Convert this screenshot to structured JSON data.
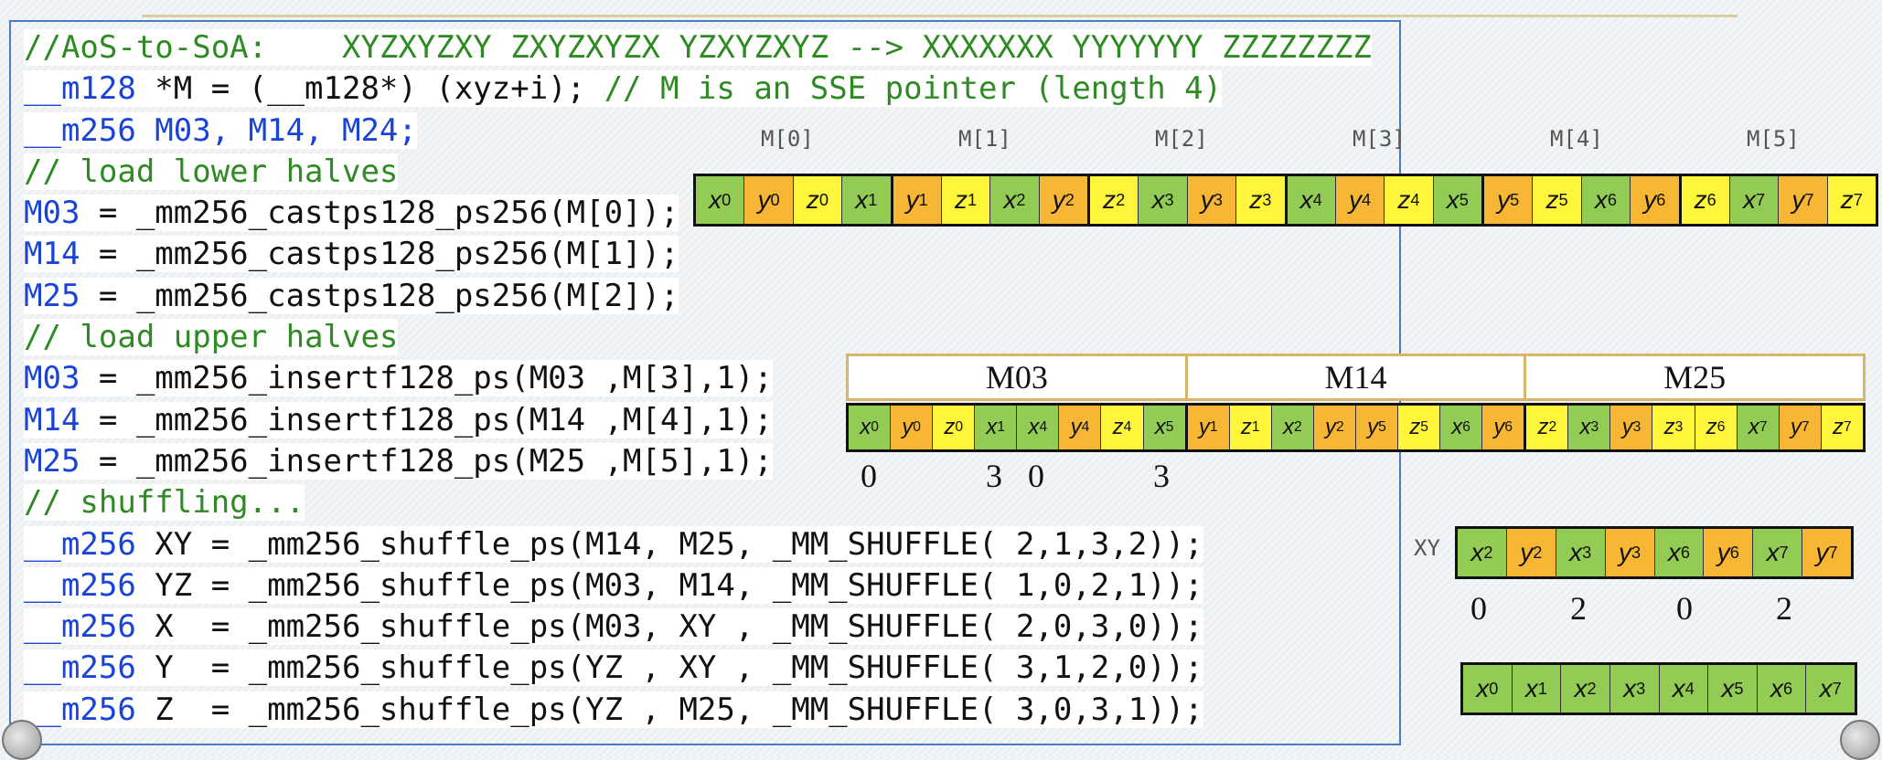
{
  "code": [
    {
      "parts": [
        {
          "t": "//AoS-to-SoA:    XYZXYZXY ZXYZXYZX YZXYZXYZ --> XXXXXXX YYYYYYY ZZZZZZZZ",
          "c": "cm"
        }
      ]
    },
    {
      "parts": [
        {
          "t": "__m128",
          "c": "kw"
        },
        {
          "t": " *M = (__m128*) (xyz+i); ",
          "c": "tx"
        },
        {
          "t": "// M is an SSE pointer (length 4)",
          "c": "cm"
        }
      ]
    },
    {
      "parts": [
        {
          "t": "__m256 M03, M14, M24;",
          "c": "kw"
        }
      ]
    },
    {
      "parts": [
        {
          "t": "// load lower halves",
          "c": "cm"
        }
      ]
    },
    {
      "parts": [
        {
          "t": "M03",
          "c": "kw"
        },
        {
          "t": " = _mm256_castps128_ps256(M[0]);",
          "c": "tx"
        }
      ]
    },
    {
      "parts": [
        {
          "t": "M14",
          "c": "kw"
        },
        {
          "t": " = _mm256_castps128_ps256(M[1]);",
          "c": "tx"
        }
      ]
    },
    {
      "parts": [
        {
          "t": "M25",
          "c": "kw"
        },
        {
          "t": " = _mm256_castps128_ps256(M[2]);",
          "c": "tx"
        }
      ]
    },
    {
      "parts": [
        {
          "t": "// load upper halves",
          "c": "cm"
        }
      ]
    },
    {
      "parts": [
        {
          "t": "M03",
          "c": "kw"
        },
        {
          "t": " = _mm256_insertf128_ps(M03 ,M[3],1);",
          "c": "tx"
        }
      ]
    },
    {
      "parts": [
        {
          "t": "M14",
          "c": "kw"
        },
        {
          "t": " = _mm256_insertf128_ps(M14 ,M[4],1);",
          "c": "tx"
        }
      ]
    },
    {
      "parts": [
        {
          "t": "M25",
          "c": "kw"
        },
        {
          "t": " = _mm256_insertf128_ps(M25 ,M[5],1);",
          "c": "tx"
        }
      ]
    },
    {
      "parts": [
        {
          "t": "// shuffling...",
          "c": "cm"
        }
      ]
    },
    {
      "parts": [
        {
          "t": "__m256",
          "c": "kw"
        },
        {
          "t": " XY = _mm256_shuffle_ps(M14, M25, _MM_SHUFFLE( 2,1,3,2));",
          "c": "tx"
        }
      ]
    },
    {
      "parts": [
        {
          "t": "__m256",
          "c": "kw"
        },
        {
          "t": " YZ = _mm256_shuffle_ps(M03, M14, _MM_SHUFFLE( 1,0,2,1));",
          "c": "tx"
        }
      ]
    },
    {
      "parts": [
        {
          "t": "__m256",
          "c": "kw"
        },
        {
          "t": " X  = _mm256_shuffle_ps(M03, XY , _MM_SHUFFLE( 2,0,3,0));",
          "c": "tx"
        }
      ]
    },
    {
      "parts": [
        {
          "t": "__m256",
          "c": "kw"
        },
        {
          "t": " Y  = _mm256_shuffle_ps(YZ , XY , _MM_SHUFFLE( 3,1,2,0));",
          "c": "tx"
        }
      ]
    },
    {
      "parts": [
        {
          "t": "__m256",
          "c": "kw"
        },
        {
          "t": " Z  = _mm256_shuffle_ps(YZ , M25, _MM_SHUFFLE( 3,0,3,1));",
          "c": "tx"
        }
      ]
    }
  ],
  "m_labels": [
    "M[0]",
    "M[1]",
    "M[2]",
    "M[3]",
    "M[4]",
    "M[5]"
  ],
  "aos_cells": [
    {
      "v": "x",
      "s": "0",
      "col": "green"
    },
    {
      "v": "y",
      "s": "0",
      "col": "orange"
    },
    {
      "v": "z",
      "s": "0",
      "col": "yellow"
    },
    {
      "v": "x",
      "s": "1",
      "col": "green"
    },
    {
      "v": "y",
      "s": "1",
      "col": "orange"
    },
    {
      "v": "z",
      "s": "1",
      "col": "yellow"
    },
    {
      "v": "x",
      "s": "2",
      "col": "green"
    },
    {
      "v": "y",
      "s": "2",
      "col": "orange"
    },
    {
      "v": "z",
      "s": "2",
      "col": "yellow"
    },
    {
      "v": "x",
      "s": "3",
      "col": "green"
    },
    {
      "v": "y",
      "s": "3",
      "col": "orange"
    },
    {
      "v": "z",
      "s": "3",
      "col": "yellow"
    },
    {
      "v": "x",
      "s": "4",
      "col": "green"
    },
    {
      "v": "y",
      "s": "4",
      "col": "orange"
    },
    {
      "v": "z",
      "s": "4",
      "col": "yellow"
    },
    {
      "v": "x",
      "s": "5",
      "col": "green"
    },
    {
      "v": "y",
      "s": "5",
      "col": "orange"
    },
    {
      "v": "z",
      "s": "5",
      "col": "yellow"
    },
    {
      "v": "x",
      "s": "6",
      "col": "green"
    },
    {
      "v": "y",
      "s": "6",
      "col": "orange"
    },
    {
      "v": "z",
      "s": "6",
      "col": "yellow"
    },
    {
      "v": "x",
      "s": "7",
      "col": "green"
    },
    {
      "v": "y",
      "s": "7",
      "col": "orange"
    },
    {
      "v": "z",
      "s": "7",
      "col": "yellow"
    }
  ],
  "reg_heads": [
    "M03",
    "M14",
    "M25"
  ],
  "reg_cells": [
    {
      "v": "x",
      "s": "0",
      "col": "green"
    },
    {
      "v": "y",
      "s": "0",
      "col": "orange"
    },
    {
      "v": "z",
      "s": "0",
      "col": "yellow"
    },
    {
      "v": "x",
      "s": "1",
      "col": "green"
    },
    {
      "v": "x",
      "s": "4",
      "col": "green"
    },
    {
      "v": "y",
      "s": "4",
      "col": "orange"
    },
    {
      "v": "z",
      "s": "4",
      "col": "yellow"
    },
    {
      "v": "x",
      "s": "5",
      "col": "green"
    },
    {
      "v": "y",
      "s": "1",
      "col": "orange"
    },
    {
      "v": "z",
      "s": "1",
      "col": "yellow"
    },
    {
      "v": "x",
      "s": "2",
      "col": "green"
    },
    {
      "v": "y",
      "s": "2",
      "col": "orange"
    },
    {
      "v": "y",
      "s": "5",
      "col": "orange"
    },
    {
      "v": "z",
      "s": "5",
      "col": "yellow"
    },
    {
      "v": "x",
      "s": "6",
      "col": "green"
    },
    {
      "v": "y",
      "s": "6",
      "col": "orange"
    },
    {
      "v": "z",
      "s": "2",
      "col": "yellow"
    },
    {
      "v": "x",
      "s": "3",
      "col": "green"
    },
    {
      "v": "y",
      "s": "3",
      "col": "orange"
    },
    {
      "v": "z",
      "s": "3",
      "col": "yellow"
    },
    {
      "v": "z",
      "s": "6",
      "col": "yellow"
    },
    {
      "v": "x",
      "s": "7",
      "col": "green"
    },
    {
      "v": "y",
      "s": "7",
      "col": "orange"
    },
    {
      "v": "z",
      "s": "7",
      "col": "yellow"
    }
  ],
  "reg_indices": [
    "0",
    "3",
    "0",
    "3"
  ],
  "xy_label": "XY",
  "xy_cells": [
    {
      "v": "x",
      "s": "2",
      "col": "green"
    },
    {
      "v": "y",
      "s": "2",
      "col": "orange"
    },
    {
      "v": "x",
      "s": "3",
      "col": "green"
    },
    {
      "v": "y",
      "s": "3",
      "col": "orange"
    },
    {
      "v": "x",
      "s": "6",
      "col": "green"
    },
    {
      "v": "y",
      "s": "6",
      "col": "orange"
    },
    {
      "v": "x",
      "s": "7",
      "col": "green"
    },
    {
      "v": "y",
      "s": "7",
      "col": "orange"
    }
  ],
  "xy_indices": [
    "0",
    "2",
    "0",
    "2"
  ],
  "x_cells": [
    {
      "v": "x",
      "s": "0",
      "col": "green"
    },
    {
      "v": "x",
      "s": "1",
      "col": "green"
    },
    {
      "v": "x",
      "s": "2",
      "col": "green"
    },
    {
      "v": "x",
      "s": "3",
      "col": "green"
    },
    {
      "v": "x",
      "s": "4",
      "col": "green"
    },
    {
      "v": "x",
      "s": "5",
      "col": "green"
    },
    {
      "v": "x",
      "s": "6",
      "col": "green"
    },
    {
      "v": "x",
      "s": "7",
      "col": "green"
    }
  ]
}
